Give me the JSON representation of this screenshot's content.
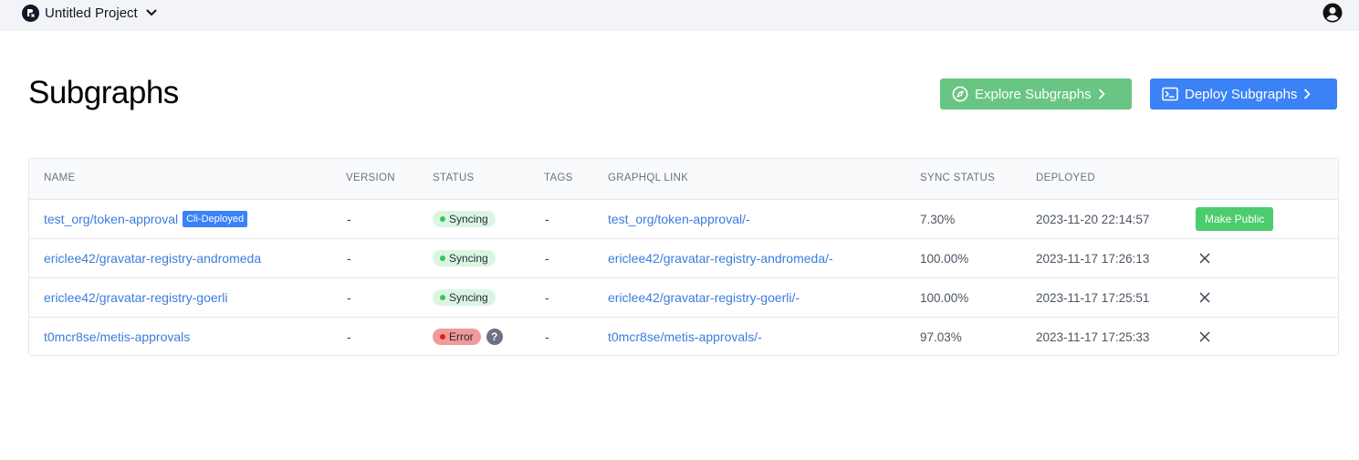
{
  "header": {
    "project_name": "Untitled Project"
  },
  "page": {
    "title": "Subgraphs",
    "explore_button": "Explore Subgraphs",
    "deploy_button": "Deploy Subgraphs"
  },
  "table": {
    "columns": [
      "NAME",
      "VERSION",
      "STATUS",
      "TAGS",
      "GRAPHQL LINK",
      "SYNC STATUS",
      "DEPLOYED"
    ],
    "rows": [
      {
        "name": "test_org/token-approval",
        "badge": "Cli-Deployed",
        "version": "-",
        "status": "Syncing",
        "tags": "-",
        "graphql_link": "test_org/token-approval/-",
        "sync_status": "7.30%",
        "deployed": "2023-11-20 22:14:57",
        "action": "Make Public"
      },
      {
        "name": "ericlee42/gravatar-registry-andromeda",
        "version": "-",
        "status": "Syncing",
        "tags": "-",
        "graphql_link": "ericlee42/gravatar-registry-andromeda/-",
        "sync_status": "100.00%",
        "deployed": "2023-11-17 17:26:13"
      },
      {
        "name": "ericlee42/gravatar-registry-goerli",
        "version": "-",
        "status": "Syncing",
        "tags": "-",
        "graphql_link": "ericlee42/gravatar-registry-goerli/-",
        "sync_status": "100.00%",
        "deployed": "2023-11-17 17:25:51"
      },
      {
        "name": "t0mcr8se/metis-approvals",
        "version": "-",
        "status": "Error",
        "help": "?",
        "tags": "-",
        "graphql_link": "t0mcr8se/metis-approvals/-",
        "sync_status": "97.03%",
        "deployed": "2023-11-17 17:25:33"
      }
    ]
  },
  "colors": {
    "accent_blue": "#3b82f6",
    "explore_green": "#68c584",
    "link": "#3b7ddd",
    "syncing_bg": "#dcf5e3",
    "error_bg": "#f19a9a",
    "make_public": "#4ccc6e"
  },
  "icons": {
    "project": "project-logo-icon",
    "dropdown": "chevron-down-icon",
    "user": "user-circle-icon",
    "explore": "compass-icon",
    "deploy": "terminal-icon",
    "arrow": "chevron-right-icon",
    "remove": "close-icon",
    "help": "question-circle-icon"
  }
}
